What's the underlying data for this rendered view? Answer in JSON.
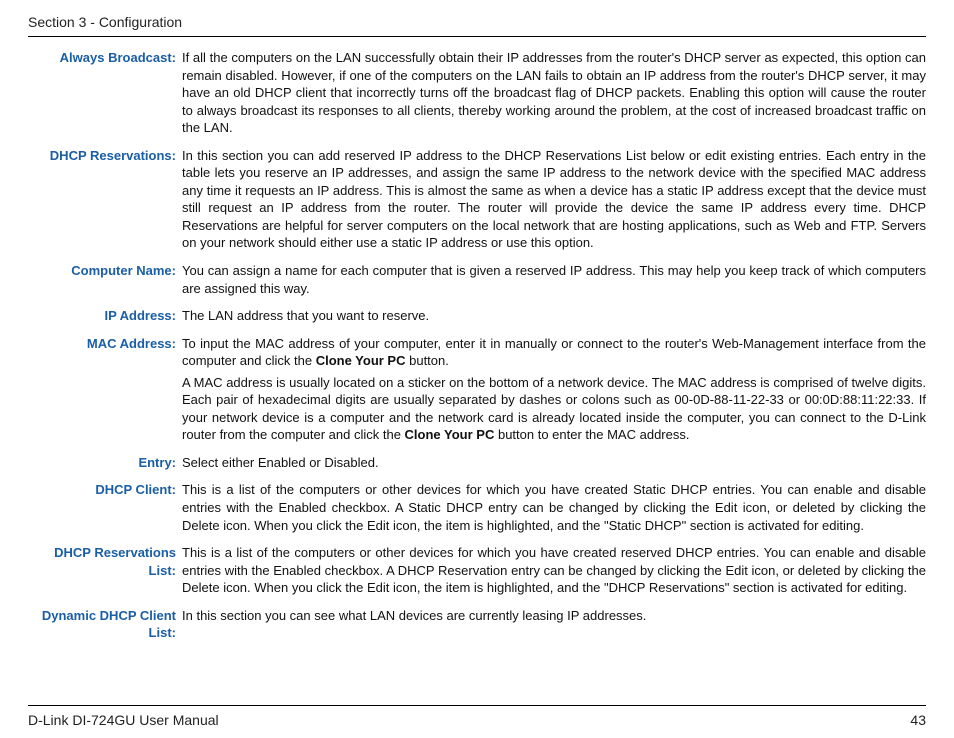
{
  "header": {
    "section": "Section 3 - Configuration"
  },
  "footer": {
    "manual": "D-Link DI-724GU User Manual",
    "page": "43"
  },
  "entries": [
    {
      "term": "Always Broadcast:",
      "paras": [
        {
          "text": "If all the computers on the LAN successfully obtain their IP addresses from the router's DHCP server as expected, this option can remain disabled. However, if one of the computers on the LAN fails to obtain an IP address from the router's DHCP server, it may have an old DHCP client that incorrectly turns off the broadcast flag of DHCP packets. Enabling this option will cause the router to always broadcast its responses to all clients, thereby working around the problem, at the cost of increased broadcast traffic on the LAN."
        }
      ]
    },
    {
      "term": "DHCP Reservations:",
      "paras": [
        {
          "text": "In this section you can add reserved IP address to the DHCP Reservations List below or edit existing entries. Each entry in the table lets you reserve an IP addresses, and assign the same IP address to the network device with the specified MAC address any time it requests an IP address. This is almost the same as when a device has a static IP address except that the device must still request an IP address from the router. The router will provide the device the same IP address every time. DHCP Reservations are helpful for server computers on the local network that are hosting applications, such as Web and FTP. Servers on your network should either use a static IP address or use this option."
        }
      ]
    },
    {
      "term": "Computer Name:",
      "paras": [
        {
          "text": "You can assign a name for each computer that is given a reserved IP address. This may help you keep track of which computers are assigned this way."
        }
      ]
    },
    {
      "term": "IP Address:",
      "paras": [
        {
          "text": "The LAN address that you want to reserve."
        }
      ]
    },
    {
      "term": "MAC Address:",
      "paras": [
        {
          "pre": "To input the MAC address of your computer, enter it in manually or connect to the router's Web-Management interface from the computer and click the ",
          "bold": "Clone Your PC",
          "post": " button."
        },
        {
          "pre": "A MAC address is usually located on a sticker on the bottom of a network device. The MAC address is comprised of twelve digits. Each pair of hexadecimal digits are usually separated by dashes or colons such as 00-0D-88-11-22-33 or 00:0D:88:11:22:33. If your network device is a computer and the network card is already located inside the computer, you can connect to the D-Link router from the computer and click the ",
          "bold": "Clone Your PC",
          "post": " button to enter the MAC address."
        }
      ]
    },
    {
      "term": "Entry:",
      "paras": [
        {
          "text": "Select either Enabled or Disabled."
        }
      ]
    },
    {
      "term": "DHCP Client:",
      "paras": [
        {
          "text": "This is a list of the computers or other devices for which you have created Static DHCP entries. You can enable and disable entries with the Enabled checkbox. A Static DHCP entry can be changed by clicking the Edit icon, or deleted by clicking the Delete icon. When you click the Edit icon, the item is highlighted, and the \"Static DHCP\" section is activated for editing."
        }
      ]
    },
    {
      "term": "DHCP Reservations List:",
      "paras": [
        {
          "text": "This is a list of the computers or other devices for which you have created reserved DHCP entries. You can enable and disable entries with the Enabled checkbox. A DHCP Reservation entry can be changed by clicking the Edit icon, or deleted by clicking the Delete icon. When you click the Edit icon, the item is highlighted, and the \"DHCP Reservations\" section is activated for editing."
        }
      ]
    },
    {
      "term": "Dynamic DHCP Client List:",
      "paras": [
        {
          "text": "In this section you can see what LAN devices are currently leasing IP addresses."
        }
      ]
    }
  ]
}
